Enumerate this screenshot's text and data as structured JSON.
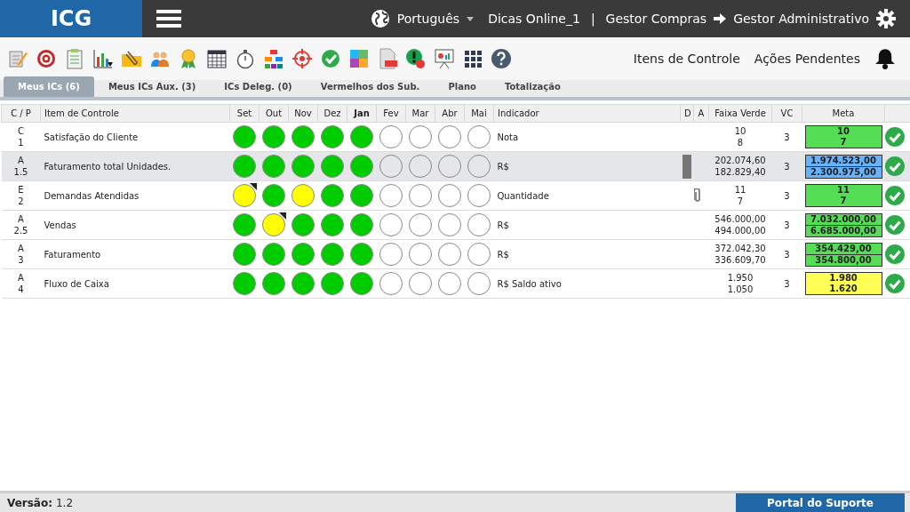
{
  "header": {
    "logo": "ICG",
    "language": "Português",
    "user": "Dicas Online_1",
    "separator": "|",
    "from_role": "Gestor Compras",
    "to_role": "Gestor Administrativo"
  },
  "toolbar_links": [
    "Itens de Controle",
    "Ações Pendentes"
  ],
  "tabs": [
    {
      "label": "Meus ICs (6)",
      "selected": true
    },
    {
      "label": "Meus ICs Aux. (3)",
      "selected": false
    },
    {
      "label": "ICs Deleg. (0)",
      "selected": false
    },
    {
      "label": "Vermelhos dos Sub.",
      "selected": false
    },
    {
      "label": "Plano",
      "selected": false
    },
    {
      "label": "Totalização",
      "selected": false
    }
  ],
  "table": {
    "columns": [
      {
        "label": "C / P",
        "bold": false
      },
      {
        "label": "Item de Controle",
        "bold": false
      },
      {
        "label": "Set",
        "bold": false
      },
      {
        "label": "Out",
        "bold": false
      },
      {
        "label": "Nov",
        "bold": false
      },
      {
        "label": "Dez",
        "bold": false
      },
      {
        "label": "Jan",
        "bold": true
      },
      {
        "label": "Fev",
        "bold": false
      },
      {
        "label": "Mar",
        "bold": false
      },
      {
        "label": "Abr",
        "bold": false
      },
      {
        "label": "Mai",
        "bold": false
      },
      {
        "label": "Indicador",
        "bold": false
      },
      {
        "label": "D",
        "bold": false
      },
      {
        "label": "A",
        "bold": false
      },
      {
        "label": "Faixa Verde",
        "bold": false
      },
      {
        "label": "VC",
        "bold": false
      },
      {
        "label": "Meta",
        "bold": false
      }
    ],
    "rows": [
      {
        "cp": [
          "C",
          "1"
        ],
        "item": "Satisfação do Cliente",
        "selected": false,
        "months": [
          {
            "filled": true,
            "color": "#00cc00",
            "flagged": false
          },
          {
            "filled": true,
            "color": "#00cc00",
            "flagged": false
          },
          {
            "filled": true,
            "color": "#00cc00",
            "flagged": false
          },
          {
            "filled": true,
            "color": "#00cc00",
            "flagged": false
          },
          {
            "filled": true,
            "color": "#00cc00",
            "flagged": false
          },
          {
            "filled": false,
            "flagged": false
          },
          {
            "filled": false,
            "flagged": false
          },
          {
            "filled": false,
            "flagged": false
          },
          {
            "filled": false,
            "flagged": false
          }
        ],
        "indicador": "Nota",
        "bar": false,
        "attachment": false,
        "faixa": [
          "10",
          "8"
        ],
        "vc": "3",
        "meta": {
          "color": "#55dd55",
          "split": false,
          "values": [
            "10",
            "7"
          ]
        },
        "done": true
      },
      {
        "cp": [
          "A",
          "1.5"
        ],
        "item": "Faturamento total Unidades.",
        "selected": true,
        "months": [
          {
            "filled": true,
            "color": "#00cc00",
            "flagged": false
          },
          {
            "filled": true,
            "color": "#00cc00",
            "flagged": false
          },
          {
            "filled": true,
            "color": "#00cc00",
            "flagged": false
          },
          {
            "filled": true,
            "color": "#00cc00",
            "flagged": false
          },
          {
            "filled": true,
            "color": "#00cc00",
            "flagged": false
          },
          {
            "filled": false,
            "flagged": false
          },
          {
            "filled": false,
            "flagged": false
          },
          {
            "filled": false,
            "flagged": false
          },
          {
            "filled": false,
            "flagged": false
          }
        ],
        "indicador": "R$",
        "bar": true,
        "attachment": false,
        "faixa": [
          "202.074,60",
          "182.829,40"
        ],
        "vc": "3",
        "meta": {
          "color": "#66b3ff",
          "split": true,
          "values": [
            "1.974.523,00",
            "2.300.975,00"
          ]
        },
        "done": true
      },
      {
        "cp": [
          "E",
          "2"
        ],
        "item": "Demandas Atendidas",
        "selected": false,
        "months": [
          {
            "filled": true,
            "color": "#ffff00",
            "flagged": true
          },
          {
            "filled": true,
            "color": "#00cc00",
            "flagged": false
          },
          {
            "filled": true,
            "color": "#ffff00",
            "flagged": false
          },
          {
            "filled": true,
            "color": "#00cc00",
            "flagged": false
          },
          {
            "filled": true,
            "color": "#00cc00",
            "flagged": false
          },
          {
            "filled": false,
            "flagged": false
          },
          {
            "filled": false,
            "flagged": false
          },
          {
            "filled": false,
            "flagged": false
          },
          {
            "filled": false,
            "flagged": false
          }
        ],
        "indicador": "Quantidade",
        "bar": false,
        "attachment": true,
        "faixa": [
          "11",
          "7"
        ],
        "vc": "3",
        "meta": {
          "color": "#55dd55",
          "split": false,
          "values": [
            "11",
            "7"
          ]
        },
        "done": true
      },
      {
        "cp": [
          "A",
          "2.5"
        ],
        "item": "Vendas",
        "selected": false,
        "months": [
          {
            "filled": true,
            "color": "#00cc00",
            "flagged": false
          },
          {
            "filled": true,
            "color": "#ffff00",
            "flagged": true
          },
          {
            "filled": true,
            "color": "#00cc00",
            "flagged": false
          },
          {
            "filled": true,
            "color": "#00cc00",
            "flagged": false
          },
          {
            "filled": true,
            "color": "#00cc00",
            "flagged": false
          },
          {
            "filled": false,
            "flagged": false
          },
          {
            "filled": false,
            "flagged": false
          },
          {
            "filled": false,
            "flagged": false
          },
          {
            "filled": false,
            "flagged": false
          }
        ],
        "indicador": "R$",
        "bar": false,
        "attachment": false,
        "faixa": [
          "546.000,00",
          "494.000,00"
        ],
        "vc": "3",
        "meta": {
          "color": "#55dd55",
          "split": true,
          "values": [
            "7.032.000,00",
            "6.685.000,00"
          ]
        },
        "done": true
      },
      {
        "cp": [
          "A",
          "3"
        ],
        "item": "Faturamento",
        "selected": false,
        "months": [
          {
            "filled": true,
            "color": "#00cc00",
            "flagged": false
          },
          {
            "filled": true,
            "color": "#00cc00",
            "flagged": false
          },
          {
            "filled": true,
            "color": "#00cc00",
            "flagged": false
          },
          {
            "filled": true,
            "color": "#00cc00",
            "flagged": false
          },
          {
            "filled": true,
            "color": "#00cc00",
            "flagged": false
          },
          {
            "filled": false,
            "flagged": false
          },
          {
            "filled": false,
            "flagged": false
          },
          {
            "filled": false,
            "flagged": false
          },
          {
            "filled": false,
            "flagged": false
          }
        ],
        "indicador": "R$",
        "bar": false,
        "attachment": false,
        "faixa": [
          "372.042,30",
          "336.609,70"
        ],
        "vc": "3",
        "meta": {
          "color": "#55dd55",
          "split": true,
          "values": [
            "354.429,00",
            "354.800,00"
          ]
        },
        "done": true
      },
      {
        "cp": [
          "A",
          "4"
        ],
        "item": "Fluxo de Caixa",
        "selected": false,
        "months": [
          {
            "filled": true,
            "color": "#00cc00",
            "flagged": false
          },
          {
            "filled": true,
            "color": "#00cc00",
            "flagged": false
          },
          {
            "filled": true,
            "color": "#00cc00",
            "flagged": false
          },
          {
            "filled": true,
            "color": "#00cc00",
            "flagged": false
          },
          {
            "filled": true,
            "color": "#00cc00",
            "flagged": false
          },
          {
            "filled": false,
            "flagged": false
          },
          {
            "filled": false,
            "flagged": false
          },
          {
            "filled": false,
            "flagged": false
          },
          {
            "filled": false,
            "flagged": false
          }
        ],
        "indicador": "R$ Saldo ativo",
        "bar": false,
        "attachment": false,
        "faixa": [
          "1.950",
          "1.050"
        ],
        "vc": "3",
        "meta": {
          "color": "#ffff55",
          "split": false,
          "values": [
            "1.980",
            "1.620"
          ]
        },
        "done": true
      }
    ]
  },
  "footer": {
    "version_label": "Versão:",
    "version": "1.2",
    "support_link": "Portal do Suporte"
  }
}
